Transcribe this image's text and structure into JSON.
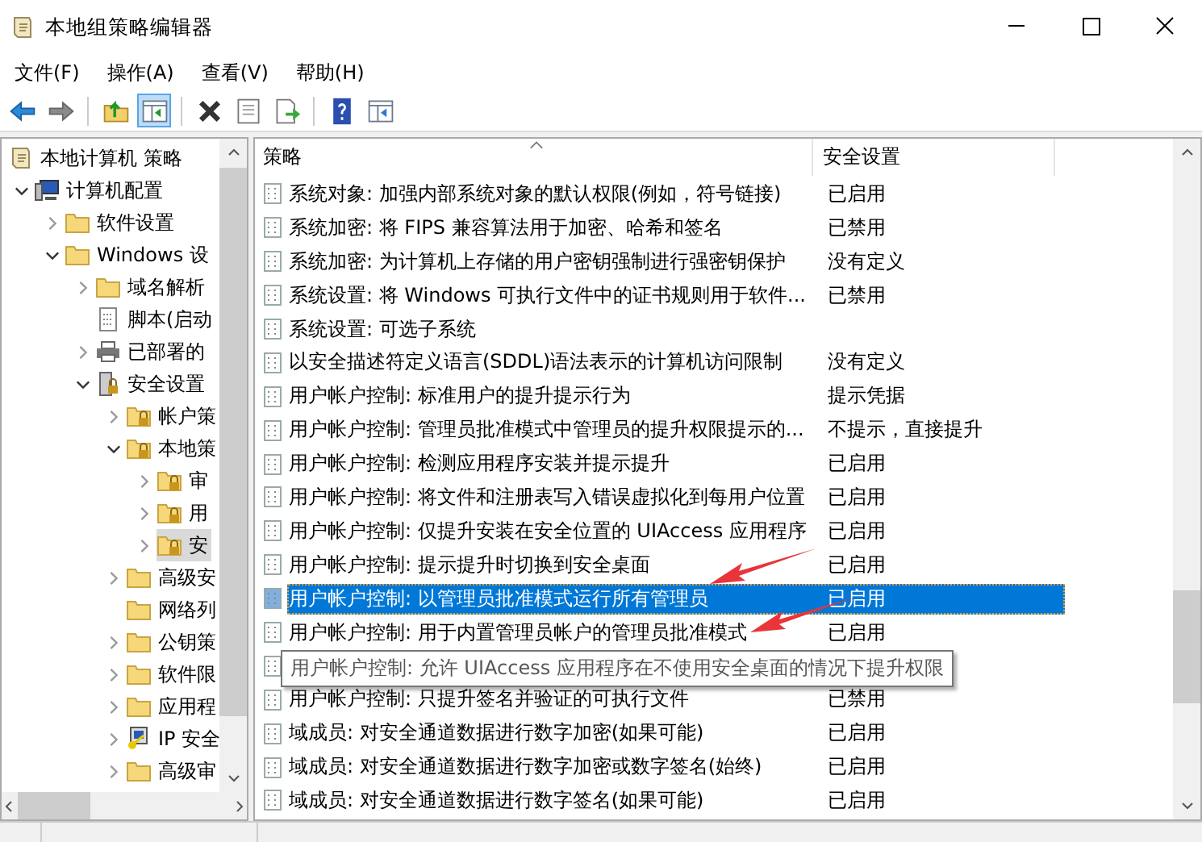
{
  "window": {
    "title": "本地组策略编辑器"
  },
  "menu": [
    "文件(F)",
    "操作(A)",
    "查看(V)",
    "帮助(H)"
  ],
  "toolbar": [
    {
      "kind": "back",
      "pressed": false
    },
    {
      "kind": "forward",
      "pressed": false
    },
    {
      "kind": "sep"
    },
    {
      "kind": "up",
      "pressed": false
    },
    {
      "kind": "tree",
      "pressed": true
    },
    {
      "kind": "sep"
    },
    {
      "kind": "delete",
      "pressed": false
    },
    {
      "kind": "properties",
      "pressed": false
    },
    {
      "kind": "export",
      "pressed": false
    },
    {
      "kind": "sep"
    },
    {
      "kind": "help",
      "pressed": false
    },
    {
      "kind": "panel",
      "pressed": false
    }
  ],
  "tree": [
    {
      "label": "本地计算机 策略",
      "kind": "scroll",
      "selected": false,
      "children": [
        {
          "label": "计算机配置",
          "kind": "computer",
          "expanded": true,
          "selected": false,
          "children": [
            {
              "label": "软件设置",
              "kind": "folder",
              "expanded": false,
              "selected": false
            },
            {
              "label": "Windows 设",
              "kind": "folder",
              "expanded": true,
              "selected": false,
              "children": [
                {
                  "label": "域名解析",
                  "kind": "folder",
                  "expanded": false,
                  "selected": false
                },
                {
                  "label": "脚本(启动",
                  "kind": "script",
                  "selected": false
                },
                {
                  "label": "已部署的",
                  "kind": "printer",
                  "expanded": false,
                  "selected": false
                },
                {
                  "label": "安全设置",
                  "kind": "security",
                  "expanded": true,
                  "selected": false,
                  "children": [
                    {
                      "label": "帐户策",
                      "kind": "lock-folder",
                      "expanded": false,
                      "selected": false
                    },
                    {
                      "label": "本地策",
                      "kind": "lock-folder",
                      "expanded": true,
                      "selected": false,
                      "children": [
                        {
                          "label": "审",
                          "kind": "lock-folder",
                          "expanded": false,
                          "selected": false
                        },
                        {
                          "label": "用",
                          "kind": "lock-folder",
                          "expanded": false,
                          "selected": false
                        },
                        {
                          "label": "安",
                          "kind": "lock-folder",
                          "expanded": false,
                          "selected": true
                        }
                      ]
                    },
                    {
                      "label": "高级安",
                      "kind": "folder",
                      "expanded": false,
                      "selected": false
                    },
                    {
                      "label": "网络列",
                      "kind": "folder",
                      "selected": false
                    },
                    {
                      "label": "公钥策",
                      "kind": "folder",
                      "expanded": false,
                      "selected": false
                    },
                    {
                      "label": "软件限",
                      "kind": "folder",
                      "expanded": false,
                      "selected": false
                    },
                    {
                      "label": "应用程",
                      "kind": "folder",
                      "expanded": false,
                      "selected": false
                    },
                    {
                      "label": "IP 安全",
                      "kind": "ip-key",
                      "expanded": false,
                      "selected": false
                    },
                    {
                      "label": "高级审",
                      "kind": "folder",
                      "expanded": false,
                      "selected": false
                    }
                  ]
                }
              ]
            }
          ]
        }
      ]
    }
  ],
  "table": {
    "columns": [
      "策略",
      "安全设置"
    ],
    "rows": [
      {
        "kind": "policy",
        "name": "系统对象: 加强内部系统对象的默认权限(例如，符号链接)",
        "setting": "已启用",
        "selected": false
      },
      {
        "kind": "policy",
        "name": "系统加密: 将 FIPS 兼容算法用于加密、哈希和签名",
        "setting": "已禁用",
        "selected": false
      },
      {
        "kind": "policy",
        "name": "系统加密: 为计算机上存储的用户密钥强制进行强密钥保护",
        "setting": "没有定义",
        "selected": false
      },
      {
        "kind": "policy",
        "name": "系统设置: 将 Windows 可执行文件中的证书规则用于软件...",
        "setting": "已禁用",
        "selected": false
      },
      {
        "kind": "policy",
        "name": "系统设置: 可选子系统",
        "selected": false
      },
      {
        "kind": "policy",
        "name": "以安全描述符定义语言(SDDL)语法表示的计算机访问限制",
        "setting": "没有定义",
        "selected": false
      },
      {
        "kind": "policy",
        "name": "用户帐户控制: 标准用户的提升提示行为",
        "setting": "提示凭据",
        "selected": false
      },
      {
        "kind": "policy",
        "name": "用户帐户控制: 管理员批准模式中管理员的提升权限提示的...",
        "setting": "不提示，直接提升",
        "selected": false
      },
      {
        "kind": "policy",
        "name": "用户帐户控制: 检测应用程序安装并提示提升",
        "setting": "已启用",
        "selected": false
      },
      {
        "kind": "policy",
        "name": "用户帐户控制: 将文件和注册表写入错误虚拟化到每用户位置",
        "setting": "已启用",
        "selected": false
      },
      {
        "kind": "policy",
        "name": "用户帐户控制: 仅提升安装在安全位置的 UIAccess 应用程序",
        "setting": "已启用",
        "selected": false
      },
      {
        "kind": "policy",
        "name": "用户帐户控制: 提示提升时切换到安全桌面",
        "setting": "已启用",
        "selected": false
      },
      {
        "kind": "policy",
        "name": "用户帐户控制: 以管理员批准模式运行所有管理员",
        "setting": "已启用",
        "selected": true
      },
      {
        "kind": "policy",
        "name": "用户帐户控制: 用于内置管理员帐户的管理员批准模式",
        "setting": "已启用",
        "selected": false
      },
      {
        "kind": "covered",
        "tooltip": "用户帐户控制: 允许 UIAccess 应用程序在不使用安全桌面的情况下提升权限"
      },
      {
        "kind": "policy",
        "name": "用户帐户控制: 只提升签名并验证的可执行文件",
        "setting": "已禁用",
        "selected": false
      },
      {
        "kind": "policy",
        "name": "域成员: 对安全通道数据进行数字加密(如果可能)",
        "setting": "已启用",
        "selected": false
      },
      {
        "kind": "policy",
        "name": "域成员: 对安全通道数据进行数字加密或数字签名(始终)",
        "setting": "已启用",
        "selected": false
      },
      {
        "kind": "policy",
        "name": "域成员: 对安全通道数据进行数字签名(如果可能)",
        "setting": "已启用",
        "selected": false
      }
    ]
  }
}
